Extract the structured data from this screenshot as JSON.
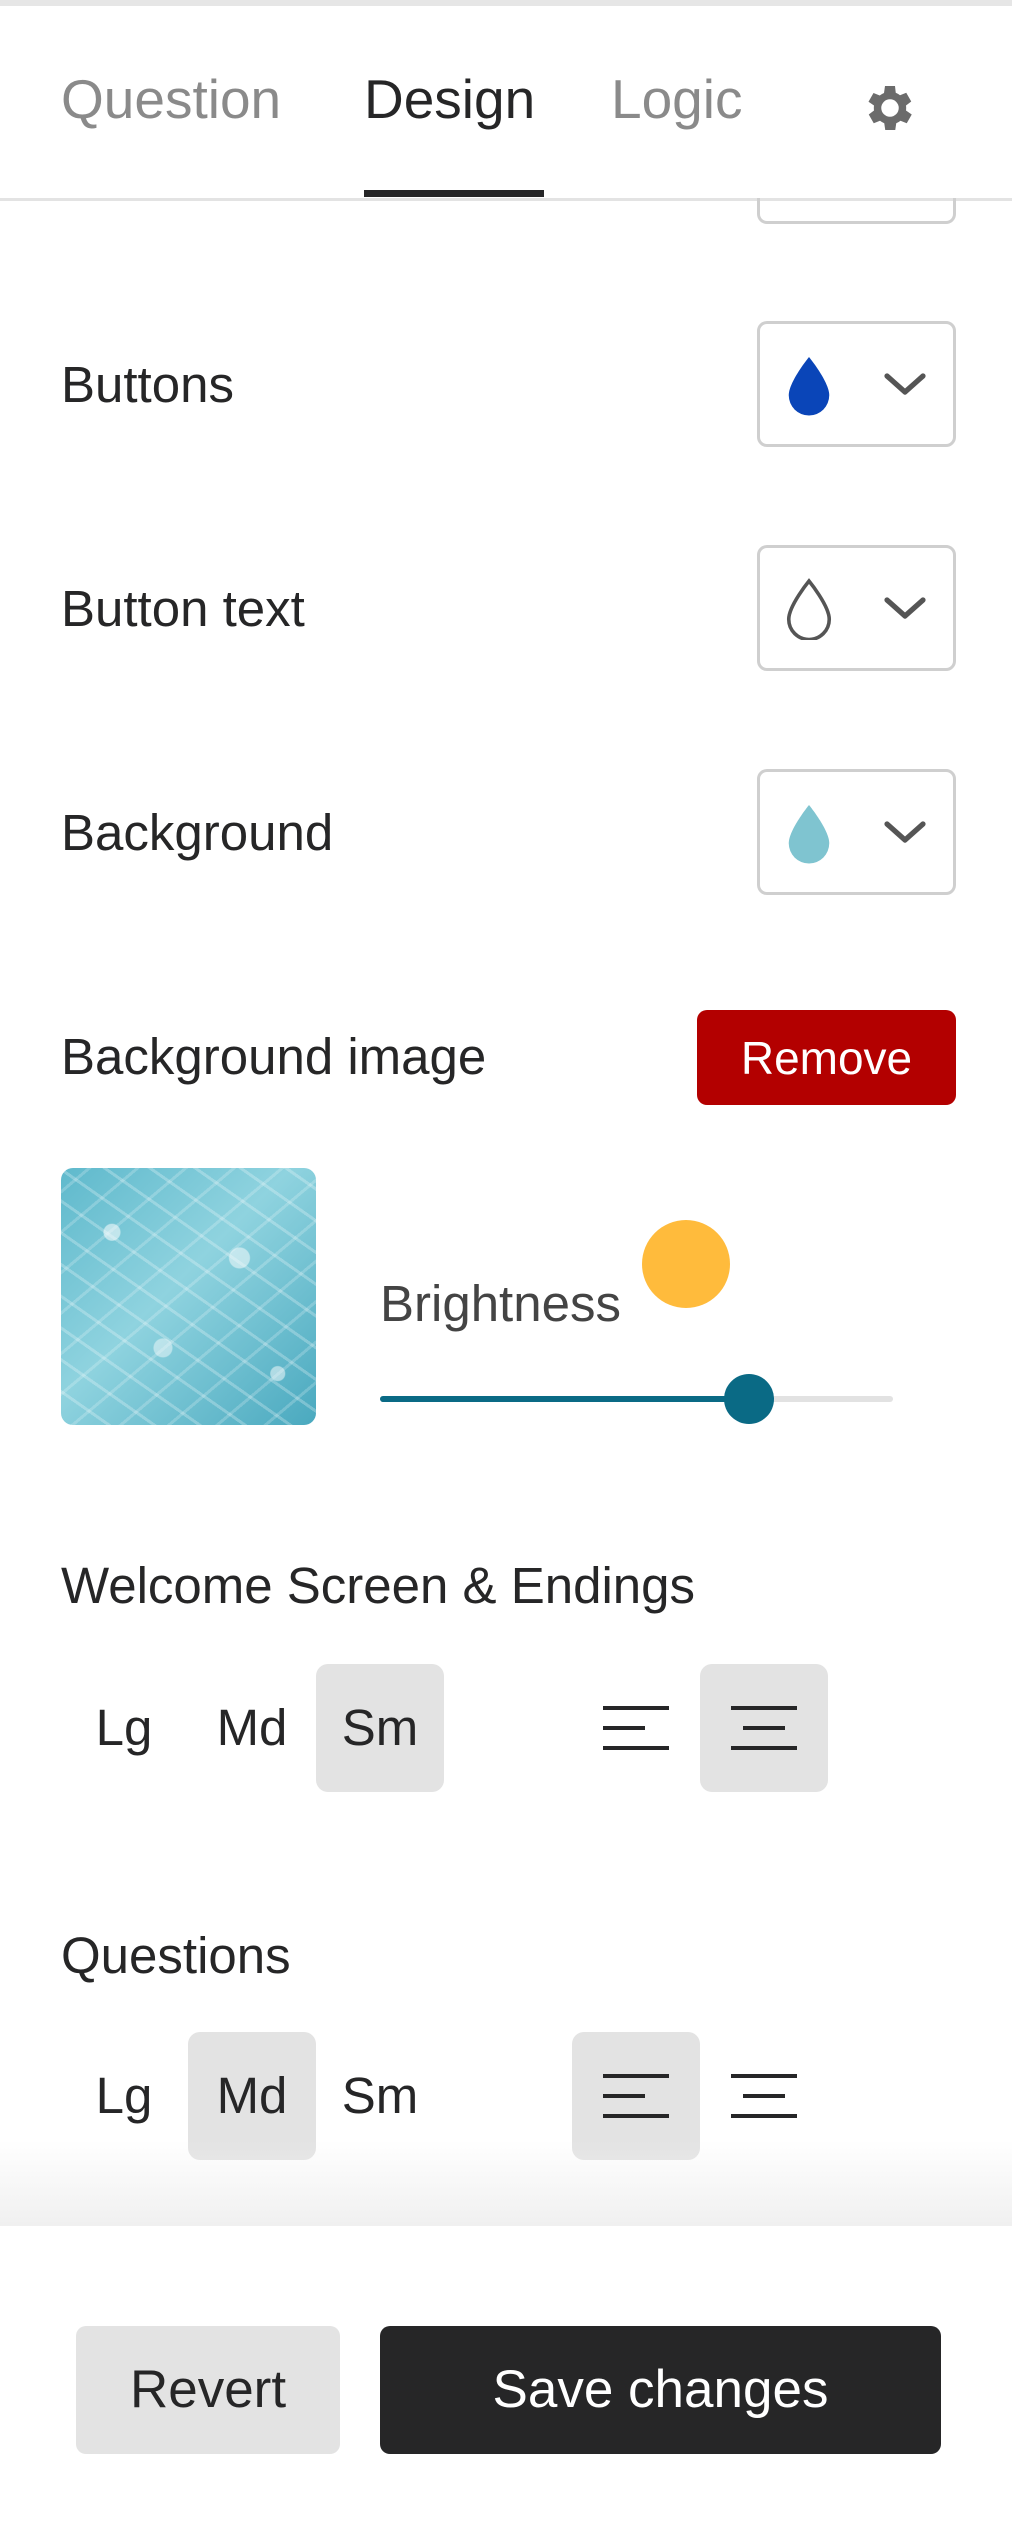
{
  "tabs": [
    {
      "label": "Question",
      "active": false
    },
    {
      "label": "Design",
      "active": true
    },
    {
      "label": "Logic",
      "active": false
    }
  ],
  "rows": {
    "buttons": {
      "label": "Buttons",
      "color": "#0a45b8",
      "icon": "drop-filled-icon"
    },
    "button_text": {
      "label": "Button text",
      "color": "#ffffff",
      "icon": "drop-outline-icon"
    },
    "background": {
      "label": "Background",
      "color": "#7fc4d0",
      "icon": "drop-filled-icon"
    }
  },
  "background_image": {
    "label": "Background image",
    "remove_label": "Remove",
    "remove_color": "#b30000"
  },
  "brightness": {
    "label": "Brightness",
    "value": 0.72,
    "accent": "#0a6a85"
  },
  "welcome": {
    "title": "Welcome Screen & Endings",
    "sizes": [
      "Lg",
      "Md",
      "Sm"
    ],
    "selected_size": "Sm",
    "selected_align": "center"
  },
  "questions": {
    "title": "Questions",
    "sizes": [
      "Lg",
      "Md",
      "Sm"
    ],
    "selected_size": "Md",
    "selected_align": "left"
  },
  "footer": {
    "revert_label": "Revert",
    "save_label": "Save changes"
  }
}
